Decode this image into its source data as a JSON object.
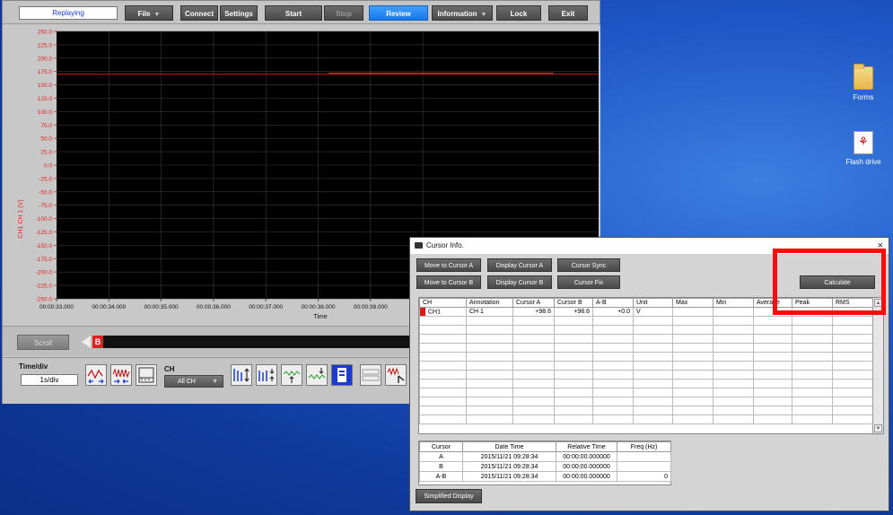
{
  "app": {
    "status": "Replaying",
    "toolbar": [
      {
        "label": "File",
        "dropdown": true,
        "state": "normal"
      },
      {
        "label": "Connect",
        "dropdown": false,
        "state": "normal"
      },
      {
        "label": "Settings",
        "dropdown": false,
        "state": "normal"
      },
      {
        "label": "Start",
        "dropdown": false,
        "state": "normal"
      },
      {
        "label": "Stop",
        "dropdown": false,
        "state": "disabled"
      },
      {
        "label": "Review",
        "dropdown": false,
        "state": "active"
      },
      {
        "label": "Information",
        "dropdown": true,
        "state": "normal"
      },
      {
        "label": "Lock",
        "dropdown": false,
        "state": "normal"
      },
      {
        "label": "Exit",
        "dropdown": false,
        "state": "normal"
      }
    ],
    "scroll_label": "Scroll",
    "scroll_marker": "B",
    "timediv_label": "Time/div",
    "timediv_value": "1s/div",
    "ch_label": "CH",
    "ch_value": "All CH"
  },
  "chart_data": {
    "type": "line",
    "xlabel": "Time",
    "ylabel": "CH1 CH 1 (V)",
    "ylim": [
      -250.0,
      250.0
    ],
    "y_ticks": [
      "250.0",
      "225.0",
      "200.0",
      "175.0",
      "150.0",
      "125.0",
      "100.0",
      "75.0",
      "50.0",
      "25.0",
      "0.0",
      "-25.0",
      "-50.0",
      "-75.0",
      "-100.0",
      "-125.0",
      "-150.0",
      "-175.0",
      "-200.0",
      "-225.0",
      "-250.0"
    ],
    "x_ticks": [
      "00:00:33.000",
      "00:00:34.000",
      "00:00:35.000",
      "00:00:36.000",
      "00:00:37.000",
      "00:00:38.000",
      "00:00:39.000",
      "00:00"
    ],
    "series": [
      {
        "name": "CH1",
        "color": "#e02020",
        "y": 170.0
      }
    ],
    "cursor_line_value": 172.0,
    "grid": true
  },
  "dialog": {
    "title": "Cursor Info.",
    "buttons": {
      "move_a": "Move to Cursor A",
      "display_a": "Display Cursor A",
      "sync": "Cursor Sync",
      "move_b": "Move to Cursor B",
      "display_b": "Display Cursor B",
      "fix": "Cursor Fix",
      "calculate": "Calculate",
      "simplified": "Simplified Display"
    },
    "table_headers": [
      "CH",
      "Annotation",
      "Cursor A",
      "Cursor B",
      "A-B",
      "Unit",
      "Max",
      "Min",
      "Average",
      "Peak",
      "RMS"
    ],
    "table_rows": [
      [
        "CH1",
        "CH 1",
        "+98.6",
        "+98.6",
        "+0.0",
        "V",
        "",
        "",
        "",
        "",
        ""
      ]
    ],
    "time_headers": [
      "Cursor",
      "Date Time",
      "Relative Time",
      "Freq (Hz)"
    ],
    "time_rows": [
      [
        "A",
        "2015/11/21 09:28:34",
        "00:00:00.000000",
        ""
      ],
      [
        "B",
        "2015/11/21 09:28:34",
        "00:00:00.000000",
        ""
      ],
      [
        "A-B",
        "2015/11/21 09:28:34",
        "00:00:00.000000",
        "0"
      ]
    ]
  },
  "desktop": {
    "icons": [
      {
        "label": "Forms",
        "icon": "folder-icon"
      },
      {
        "label": "Flash drive",
        "icon": "pdf-icon"
      }
    ]
  },
  "highlight_color": "#ff0a0a"
}
